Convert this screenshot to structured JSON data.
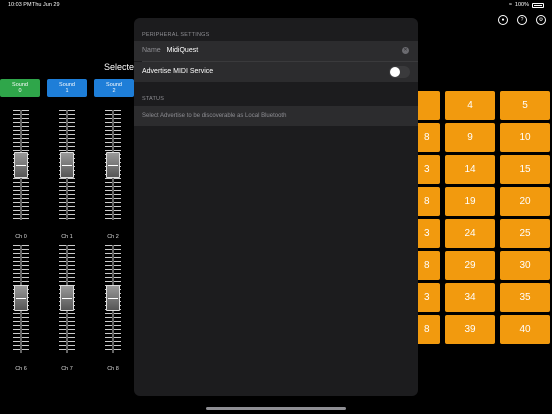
{
  "status_bar": {
    "time": "10:03 PM",
    "date": "Thu Jun 29",
    "battery": "100%"
  },
  "toolbar": {
    "icons": [
      "bluetooth-midi-icon",
      "help-icon",
      "settings-icon"
    ]
  },
  "background": {
    "selected_label": "Selectec",
    "sound_buttons": [
      {
        "line1": "Sound",
        "line2": "0",
        "color": "#2fa64a"
      },
      {
        "line1": "Sound",
        "line2": "1",
        "color": "#1e7ed8"
      },
      {
        "line1": "Sound",
        "line2": "2",
        "color": "#1e7ed8"
      }
    ],
    "channels_top": [
      "Ch 0",
      "Ch 1",
      "Ch 2"
    ],
    "channels_bottom": [
      "Ch 6",
      "Ch 7",
      "Ch 8"
    ],
    "pads_partial": [
      "8",
      "3",
      "8",
      "3",
      "8",
      "3",
      "8"
    ],
    "pads_col1": [
      "4",
      "9",
      "14",
      "19",
      "24",
      "29",
      "34",
      "39"
    ],
    "pads_col2": [
      "5",
      "10",
      "15",
      "20",
      "25",
      "30",
      "35",
      "40"
    ],
    "pad_color": "#f29a0e"
  },
  "modal": {
    "peripheral_header": "PERIPHERAL SETTINGS",
    "name_label": "Name",
    "name_value": "MidiQuest",
    "advertise_label": "Advertise MIDI Service",
    "advertise_on": false,
    "status_header": "STATUS",
    "status_text": "Select Advertise to be discoverable as Local Bluetooth"
  }
}
